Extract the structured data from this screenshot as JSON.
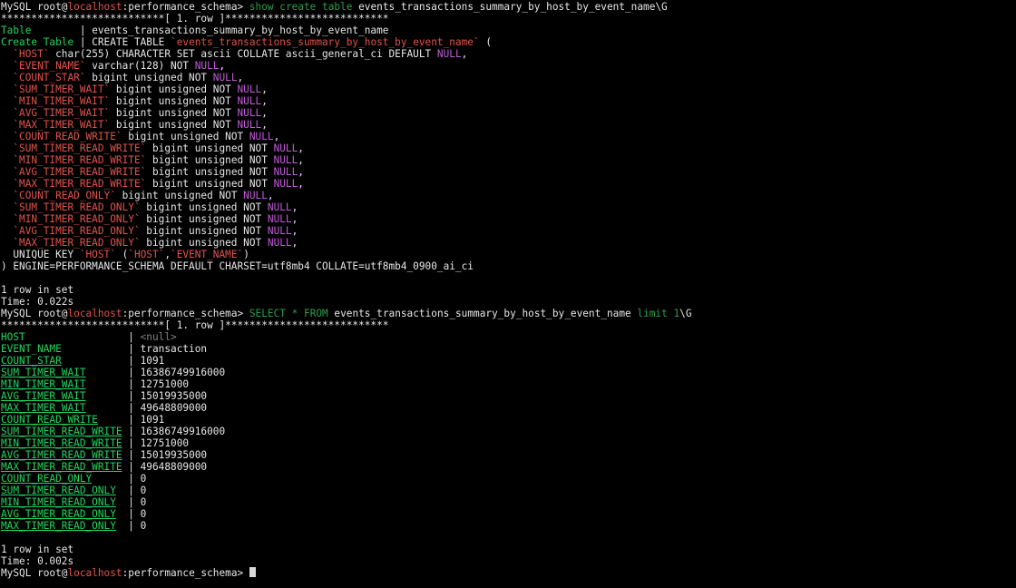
{
  "colors": {
    "default": "#e6e6e6",
    "prompt_host": "#e0534b",
    "keyword": "#2e9b4e",
    "identifier": "#e0534b",
    "null_keyword": "#c15bd8",
    "field": "#22d55e",
    "stars": "#e6e6e6",
    "null_value": "#808080",
    "literal": "#2e9b4e"
  },
  "lines": [
    {
      "segments": [
        {
          "text": "MySQL ",
          "color": "default"
        },
        {
          "text": "root",
          "color": "default"
        },
        {
          "text": "@",
          "color": "default"
        },
        {
          "text": "localhost",
          "color": "prompt_host"
        },
        {
          "text": ":performance_schema> ",
          "color": "default"
        },
        {
          "text": "show create table",
          "color": "keyword"
        },
        {
          "text": " events_transactions_summary_by_host_by_event_name\\G",
          "color": "default"
        }
      ]
    },
    {
      "segments": [
        {
          "text": "***************************[ 1. row ]***************************",
          "color": "stars"
        }
      ]
    },
    {
      "segments": [
        {
          "text": "Table",
          "color": "field"
        },
        {
          "text": "        | events_transactions_summary_by_host_by_event_name",
          "color": "default"
        }
      ]
    },
    {
      "segments": [
        {
          "text": "Create Table",
          "color": "field"
        },
        {
          "text": " | CREATE TABLE ",
          "color": "default"
        },
        {
          "text": "`events_transactions_summary_by_host_by_event_name`",
          "color": "identifier"
        },
        {
          "text": " (",
          "color": "default"
        }
      ]
    },
    {
      "segments": [
        {
          "text": "  ",
          "color": "default"
        },
        {
          "text": "`HOST`",
          "color": "identifier"
        },
        {
          "text": " char(255) CHARACTER SET ascii COLLATE ascii_general_ci DEFAULT ",
          "color": "default"
        },
        {
          "text": "NULL",
          "color": "null_keyword"
        },
        {
          "text": ",",
          "color": "default"
        }
      ]
    },
    {
      "segments": [
        {
          "text": "  ",
          "color": "default"
        },
        {
          "text": "`EVENT_NAME`",
          "color": "identifier"
        },
        {
          "text": " varchar(128) NOT ",
          "color": "default"
        },
        {
          "text": "NULL",
          "color": "null_keyword"
        },
        {
          "text": ",",
          "color": "default"
        }
      ]
    },
    {
      "segments": [
        {
          "text": "  ",
          "color": "default"
        },
        {
          "text": "`COUNT_STAR`",
          "color": "identifier"
        },
        {
          "text": " bigint unsigned NOT ",
          "color": "default"
        },
        {
          "text": "NULL",
          "color": "null_keyword"
        },
        {
          "text": ",",
          "color": "default"
        }
      ]
    },
    {
      "segments": [
        {
          "text": "  ",
          "color": "default"
        },
        {
          "text": "`SUM_TIMER_WAIT`",
          "color": "identifier"
        },
        {
          "text": " bigint unsigned NOT ",
          "color": "default"
        },
        {
          "text": "NULL",
          "color": "null_keyword"
        },
        {
          "text": ",",
          "color": "default"
        }
      ]
    },
    {
      "segments": [
        {
          "text": "  ",
          "color": "default"
        },
        {
          "text": "`MIN_TIMER_WAIT`",
          "color": "identifier"
        },
        {
          "text": " bigint unsigned NOT ",
          "color": "default"
        },
        {
          "text": "NULL",
          "color": "null_keyword"
        },
        {
          "text": ",",
          "color": "default"
        }
      ]
    },
    {
      "segments": [
        {
          "text": "  ",
          "color": "default"
        },
        {
          "text": "`AVG_TIMER_WAIT`",
          "color": "identifier"
        },
        {
          "text": " bigint unsigned NOT ",
          "color": "default"
        },
        {
          "text": "NULL",
          "color": "null_keyword"
        },
        {
          "text": ",",
          "color": "default"
        }
      ]
    },
    {
      "segments": [
        {
          "text": "  ",
          "color": "default"
        },
        {
          "text": "`MAX_TIMER_WAIT`",
          "color": "identifier"
        },
        {
          "text": " bigint unsigned NOT ",
          "color": "default"
        },
        {
          "text": "NULL",
          "color": "null_keyword"
        },
        {
          "text": ",",
          "color": "default"
        }
      ]
    },
    {
      "segments": [
        {
          "text": "  ",
          "color": "default"
        },
        {
          "text": "`COUNT_READ_WRITE`",
          "color": "identifier"
        },
        {
          "text": " bigint unsigned NOT ",
          "color": "default"
        },
        {
          "text": "NULL",
          "color": "null_keyword"
        },
        {
          "text": ",",
          "color": "default"
        }
      ]
    },
    {
      "segments": [
        {
          "text": "  ",
          "color": "default"
        },
        {
          "text": "`SUM_TIMER_READ_WRITE`",
          "color": "identifier"
        },
        {
          "text": " bigint unsigned NOT ",
          "color": "default"
        },
        {
          "text": "NULL",
          "color": "null_keyword"
        },
        {
          "text": ",",
          "color": "default"
        }
      ]
    },
    {
      "segments": [
        {
          "text": "  ",
          "color": "default"
        },
        {
          "text": "`MIN_TIMER_READ_WRITE`",
          "color": "identifier"
        },
        {
          "text": " bigint unsigned NOT ",
          "color": "default"
        },
        {
          "text": "NULL",
          "color": "null_keyword"
        },
        {
          "text": ",",
          "color": "default"
        }
      ]
    },
    {
      "segments": [
        {
          "text": "  ",
          "color": "default"
        },
        {
          "text": "`AVG_TIMER_READ_WRITE`",
          "color": "identifier"
        },
        {
          "text": " bigint unsigned NOT ",
          "color": "default"
        },
        {
          "text": "NULL",
          "color": "null_keyword"
        },
        {
          "text": ",",
          "color": "default"
        }
      ]
    },
    {
      "segments": [
        {
          "text": "  ",
          "color": "default"
        },
        {
          "text": "`MAX_TIMER_READ_WRITE`",
          "color": "identifier"
        },
        {
          "text": " bigint unsigned NOT ",
          "color": "default"
        },
        {
          "text": "NULL",
          "color": "null_keyword"
        },
        {
          "text": ",",
          "color": "default"
        }
      ]
    },
    {
      "segments": [
        {
          "text": "  ",
          "color": "default"
        },
        {
          "text": "`COUNT_READ_ONLY`",
          "color": "identifier"
        },
        {
          "text": " bigint unsigned NOT ",
          "color": "default"
        },
        {
          "text": "NULL",
          "color": "null_keyword"
        },
        {
          "text": ",",
          "color": "default"
        }
      ]
    },
    {
      "segments": [
        {
          "text": "  ",
          "color": "default"
        },
        {
          "text": "`SUM_TIMER_READ_ONLY`",
          "color": "identifier"
        },
        {
          "text": " bigint unsigned NOT ",
          "color": "default"
        },
        {
          "text": "NULL",
          "color": "null_keyword"
        },
        {
          "text": ",",
          "color": "default"
        }
      ]
    },
    {
      "segments": [
        {
          "text": "  ",
          "color": "default"
        },
        {
          "text": "`MIN_TIMER_READ_ONLY`",
          "color": "identifier"
        },
        {
          "text": " bigint unsigned NOT ",
          "color": "default"
        },
        {
          "text": "NULL",
          "color": "null_keyword"
        },
        {
          "text": ",",
          "color": "default"
        }
      ]
    },
    {
      "segments": [
        {
          "text": "  ",
          "color": "default"
        },
        {
          "text": "`AVG_TIMER_READ_ONLY`",
          "color": "identifier"
        },
        {
          "text": " bigint unsigned NOT ",
          "color": "default"
        },
        {
          "text": "NULL",
          "color": "null_keyword"
        },
        {
          "text": ",",
          "color": "default"
        }
      ]
    },
    {
      "segments": [
        {
          "text": "  ",
          "color": "default"
        },
        {
          "text": "`MAX_TIMER_READ_ONLY`",
          "color": "identifier"
        },
        {
          "text": " bigint unsigned NOT ",
          "color": "default"
        },
        {
          "text": "NULL",
          "color": "null_keyword"
        },
        {
          "text": ",",
          "color": "default"
        }
      ]
    },
    {
      "segments": [
        {
          "text": "  UNIQUE KEY ",
          "color": "default"
        },
        {
          "text": "`HOST`",
          "color": "identifier"
        },
        {
          "text": " (",
          "color": "default"
        },
        {
          "text": "`HOST`",
          "color": "identifier"
        },
        {
          "text": ",",
          "color": "default"
        },
        {
          "text": "`EVENT_NAME`",
          "color": "identifier"
        },
        {
          "text": ")",
          "color": "default"
        }
      ]
    },
    {
      "segments": [
        {
          "text": ") ENGINE=PERFORMANCE_SCHEMA DEFAULT CHARSET=utf8mb4 COLLATE=utf8mb4_0900_ai_ci",
          "color": "default"
        }
      ]
    },
    {
      "segments": [
        {
          "text": "",
          "color": "default"
        }
      ]
    },
    {
      "segments": [
        {
          "text": "1 row in set",
          "color": "default"
        }
      ]
    },
    {
      "segments": [
        {
          "text": "Time: 0.022s",
          "color": "default"
        }
      ]
    },
    {
      "segments": [
        {
          "text": "MySQL ",
          "color": "default"
        },
        {
          "text": "root",
          "color": "default"
        },
        {
          "text": "@",
          "color": "default"
        },
        {
          "text": "localhost",
          "color": "prompt_host"
        },
        {
          "text": ":performance_schema> ",
          "color": "default"
        },
        {
          "text": "SELECT",
          "color": "keyword"
        },
        {
          "text": " ",
          "color": "default"
        },
        {
          "text": "*",
          "color": "keyword"
        },
        {
          "text": " ",
          "color": "default"
        },
        {
          "text": "FROM",
          "color": "keyword"
        },
        {
          "text": " events_transactions_summary_by_host_by_event_name ",
          "color": "default"
        },
        {
          "text": "limit",
          "color": "keyword"
        },
        {
          "text": " ",
          "color": "default"
        },
        {
          "text": "1",
          "color": "literal"
        },
        {
          "text": "\\G",
          "color": "default"
        }
      ]
    },
    {
      "segments": [
        {
          "text": "***************************[ 1. row ]***************************",
          "color": "stars"
        }
      ]
    },
    {
      "segments": [
        {
          "text": "HOST",
          "color": "field"
        },
        {
          "text": "                 | ",
          "color": "default"
        },
        {
          "text": "<null>",
          "color": "null_value"
        }
      ]
    },
    {
      "segments": [
        {
          "text": "EVENT_NAME",
          "color": "field"
        },
        {
          "text": "           | transaction",
          "color": "default"
        }
      ]
    },
    {
      "segments": [
        {
          "text": "COUNT_STAR",
          "color": "field",
          "underline": true
        },
        {
          "text": "           | 1091",
          "color": "default"
        }
      ]
    },
    {
      "segments": [
        {
          "text": "SUM_TIMER_WAIT",
          "color": "field",
          "underline": true
        },
        {
          "text": "       | 16386749916000",
          "color": "default"
        }
      ]
    },
    {
      "segments": [
        {
          "text": "MIN_TIMER_WAIT",
          "color": "field",
          "underline": true
        },
        {
          "text": "       | 12751000",
          "color": "default"
        }
      ]
    },
    {
      "segments": [
        {
          "text": "AVG_TIMER_WAIT",
          "color": "field",
          "underline": true
        },
        {
          "text": "       | 15019935000",
          "color": "default"
        }
      ]
    },
    {
      "segments": [
        {
          "text": "MAX_TIMER_WAIT",
          "color": "field",
          "underline": true
        },
        {
          "text": "       | 49648809000",
          "color": "default"
        }
      ]
    },
    {
      "segments": [
        {
          "text": "COUNT_READ_WRITE",
          "color": "field",
          "underline": true
        },
        {
          "text": "     | 1091",
          "color": "default"
        }
      ]
    },
    {
      "segments": [
        {
          "text": "SUM_TIMER_READ_WRITE",
          "color": "field",
          "underline": true
        },
        {
          "text": " | 16386749916000",
          "color": "default"
        }
      ]
    },
    {
      "segments": [
        {
          "text": "MIN_TIMER_READ_WRITE",
          "color": "field",
          "underline": true
        },
        {
          "text": " | 12751000",
          "color": "default"
        }
      ]
    },
    {
      "segments": [
        {
          "text": "AVG_TIMER_READ_WRITE",
          "color": "field",
          "underline": true
        },
        {
          "text": " | 15019935000",
          "color": "default"
        }
      ]
    },
    {
      "segments": [
        {
          "text": "MAX_TIMER_READ_WRITE",
          "color": "field",
          "underline": true
        },
        {
          "text": " | 49648809000",
          "color": "default"
        }
      ]
    },
    {
      "segments": [
        {
          "text": "COUNT_READ_ONLY",
          "color": "field",
          "underline": true
        },
        {
          "text": "      | 0",
          "color": "default"
        }
      ]
    },
    {
      "segments": [
        {
          "text": "SUM_TIMER_READ_ONLY",
          "color": "field",
          "underline": true
        },
        {
          "text": "  | 0",
          "color": "default"
        }
      ]
    },
    {
      "segments": [
        {
          "text": "MIN_TIMER_READ_ONLY",
          "color": "field",
          "underline": true
        },
        {
          "text": "  | 0",
          "color": "default"
        }
      ]
    },
    {
      "segments": [
        {
          "text": "AVG_TIMER_READ_ONLY",
          "color": "field",
          "underline": true
        },
        {
          "text": "  | 0",
          "color": "default"
        }
      ]
    },
    {
      "segments": [
        {
          "text": "MAX_TIMER_READ_ONLY",
          "color": "field",
          "underline": true
        },
        {
          "text": "  | 0",
          "color": "default"
        }
      ]
    },
    {
      "segments": [
        {
          "text": "",
          "color": "default"
        }
      ]
    },
    {
      "segments": [
        {
          "text": "1 row in set",
          "color": "default"
        }
      ]
    },
    {
      "segments": [
        {
          "text": "Time: 0.002s",
          "color": "default"
        }
      ]
    },
    {
      "segments": [
        {
          "text": "MySQL ",
          "color": "default"
        },
        {
          "text": "root",
          "color": "default"
        },
        {
          "text": "@",
          "color": "default"
        },
        {
          "text": "localhost",
          "color": "prompt_host"
        },
        {
          "text": ":performance_schema> ",
          "color": "default"
        }
      ],
      "cursor": true
    }
  ]
}
